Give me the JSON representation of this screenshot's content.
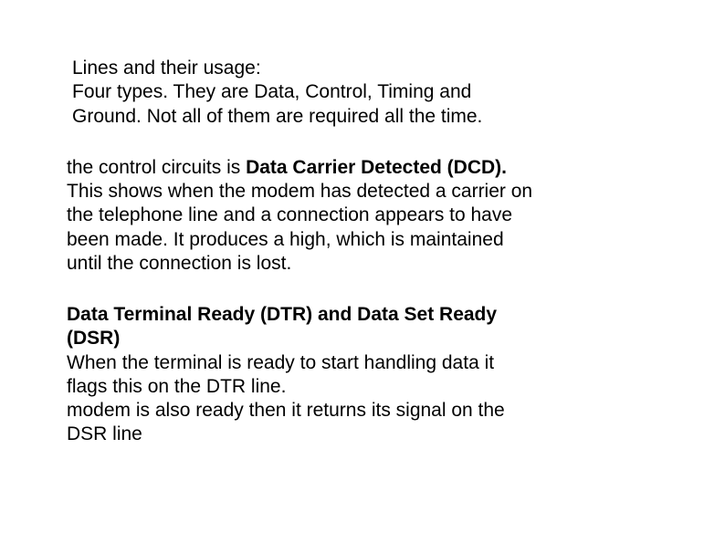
{
  "para1": {
    "line1": "Lines and their usage:",
    "line2": "Four types. They are Data, Control, Timing and",
    "line3": "Ground. Not all of them are required all the time."
  },
  "para2": {
    "pre": "the control circuits is ",
    "bold": "Data Carrier Detected (DCD).",
    "line2": "This shows when the modem has detected a carrier on",
    "line3": "the telephone line and a connection appears to have",
    "line4": "been made. It produces a high, which is maintained",
    "line5": "until the connection is lost."
  },
  "para3": {
    "bold1": "Data Terminal Ready (DTR) and Data Set Ready",
    "bold2": "(DSR)",
    "line3": "When the terminal is ready to start handling data it",
    "line4": "flags this on the DTR line.",
    "line5": "modem is also ready then it returns its signal on the",
    "line6": "DSR line"
  }
}
